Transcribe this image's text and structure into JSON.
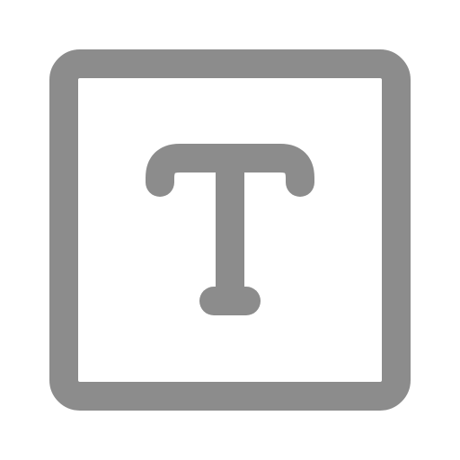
{
  "icon": {
    "name": "text-box-icon",
    "color": "#8c8c8c",
    "background": "#ffffff"
  }
}
